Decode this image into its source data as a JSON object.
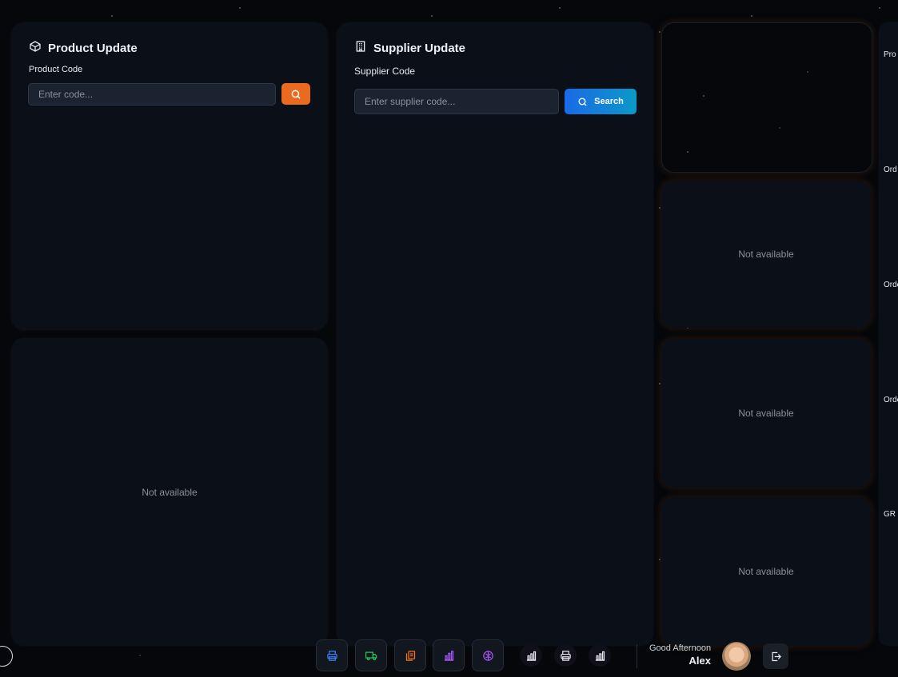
{
  "product_update": {
    "title": "Product Update",
    "field_label": "Product Code",
    "input_placeholder": "Enter code...",
    "icon": "box-icon"
  },
  "supplier_update": {
    "title": "Supplier Update",
    "field_label": "Supplier Code",
    "input_placeholder": "Enter supplier code...",
    "search_label": "Search",
    "icon": "building-icon"
  },
  "panels": {
    "not_available": "Not available"
  },
  "right_edge_labels": [
    "Pro",
    "Ord",
    "Orde",
    "Orde",
    "GR"
  ],
  "dock": {
    "buttons": [
      {
        "name": "printer-icon",
        "color": "#3b82f6"
      },
      {
        "name": "truck-icon",
        "color": "#22c55e"
      },
      {
        "name": "clipboard-copy-icon",
        "color": "#f97316"
      },
      {
        "name": "bar-chart-icon",
        "color": "#a855f7"
      },
      {
        "name": "brain-icon",
        "color": "#a855f7"
      }
    ],
    "small_buttons": [
      {
        "name": "bar-chart-icon",
        "color": "#e5e7eb"
      },
      {
        "name": "printer-icon",
        "color": "#e5e7eb"
      },
      {
        "name": "bar-chart-icon",
        "color": "#e5e7eb"
      }
    ]
  },
  "user": {
    "greeting": "Good Afternoon",
    "name": "Alex"
  },
  "colors": {
    "accent_orange": "#ea6a1f",
    "accent_blue": "#1a6ae6",
    "card_bg": "#0b0f18"
  }
}
